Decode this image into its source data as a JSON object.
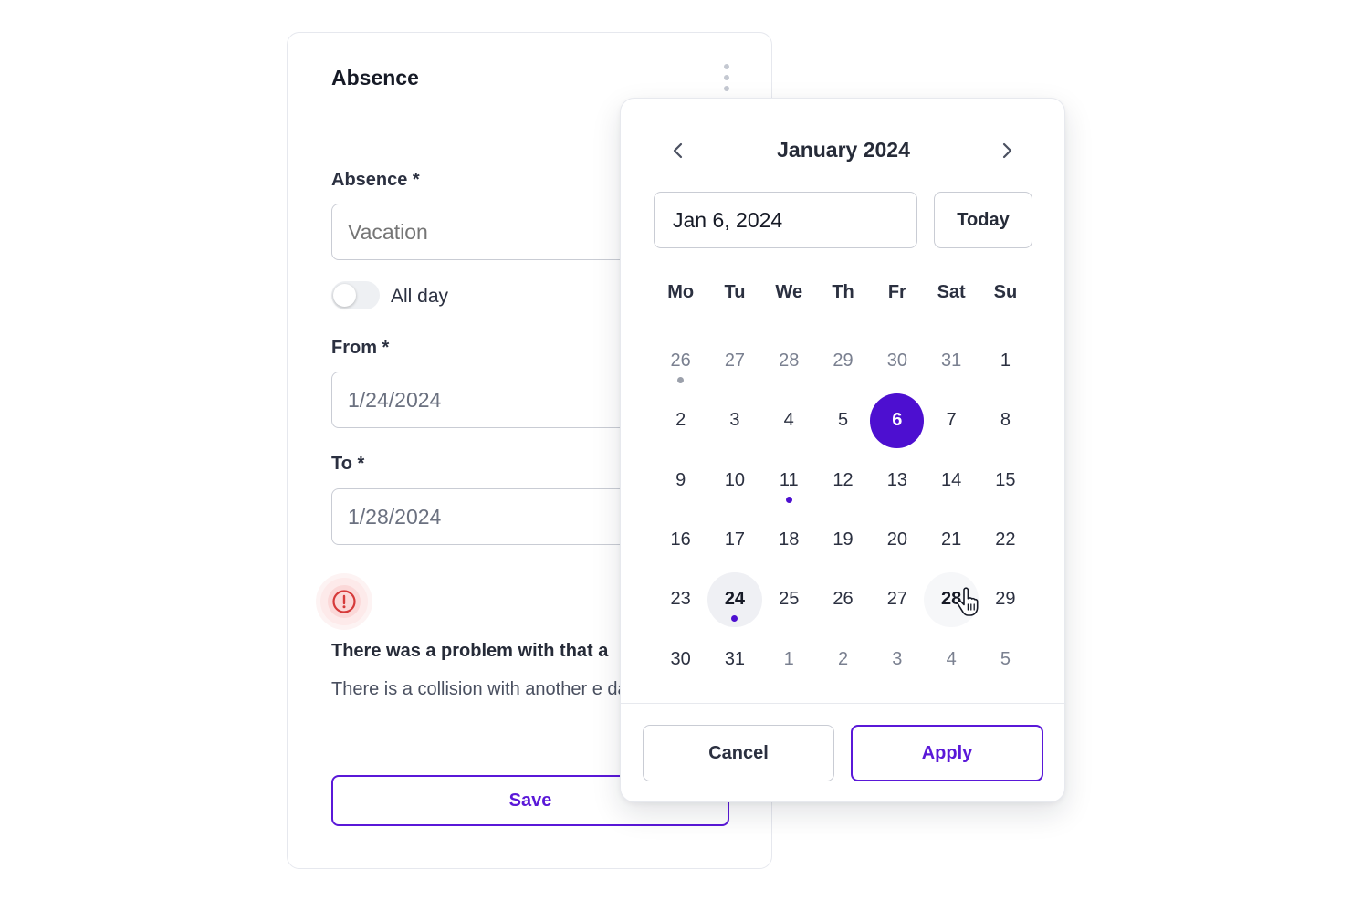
{
  "form": {
    "title": "Absence",
    "absence_label": "Absence *",
    "absence_value": "Vacation",
    "all_day_label": "All day",
    "all_day_on": false,
    "from_label": "From *",
    "from_value": "1/24/2024",
    "to_label": "To *",
    "to_value": "1/28/2024",
    "alert_title": "There was a problem with that a",
    "alert_text": "There is a collision with another e days.",
    "save_label": "Save"
  },
  "picker": {
    "month_title": "January 2024",
    "date_value": "Jan 6, 2024",
    "today_label": "Today",
    "weekdays": [
      "Mo",
      "Tu",
      "We",
      "Th",
      "Fr",
      "Sat",
      "Su"
    ],
    "days": [
      {
        "n": "26",
        "muted": true,
        "dot": "gray"
      },
      {
        "n": "27",
        "muted": true
      },
      {
        "n": "28",
        "muted": true
      },
      {
        "n": "29",
        "muted": true
      },
      {
        "n": "30",
        "muted": true
      },
      {
        "n": "31",
        "muted": true
      },
      {
        "n": "1"
      },
      {
        "n": "2"
      },
      {
        "n": "3"
      },
      {
        "n": "4"
      },
      {
        "n": "5"
      },
      {
        "n": "6",
        "state": "selected"
      },
      {
        "n": "7"
      },
      {
        "n": "8"
      },
      {
        "n": "9"
      },
      {
        "n": "10"
      },
      {
        "n": "11",
        "dot": "accent"
      },
      {
        "n": "12"
      },
      {
        "n": "13"
      },
      {
        "n": "14"
      },
      {
        "n": "15"
      },
      {
        "n": "16"
      },
      {
        "n": "17"
      },
      {
        "n": "18"
      },
      {
        "n": "19"
      },
      {
        "n": "20"
      },
      {
        "n": "21"
      },
      {
        "n": "22"
      },
      {
        "n": "23"
      },
      {
        "n": "24",
        "state": "range-edge",
        "dot": "accent"
      },
      {
        "n": "25"
      },
      {
        "n": "26"
      },
      {
        "n": "27"
      },
      {
        "n": "28",
        "state": "hovered"
      },
      {
        "n": "29"
      },
      {
        "n": "30"
      },
      {
        "n": "31"
      },
      {
        "n": "1",
        "muted": true
      },
      {
        "n": "2",
        "muted": true
      },
      {
        "n": "3",
        "muted": true
      },
      {
        "n": "4",
        "muted": true
      },
      {
        "n": "5",
        "muted": true
      }
    ],
    "cancel_label": "Cancel",
    "apply_label": "Apply"
  },
  "colors": {
    "accent": "#5a18d8",
    "selected": "#4d0fd0",
    "error": "#d63a3a"
  },
  "icons": {
    "prev": "chevron-left-icon",
    "next": "chevron-right-icon",
    "alert": "alert-circle-icon",
    "menu": "kebab-menu-icon",
    "cursor": "hand-pointer-icon"
  }
}
